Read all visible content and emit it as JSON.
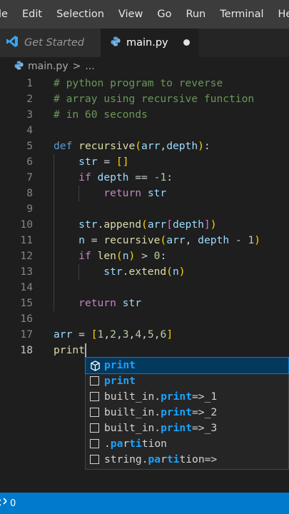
{
  "menubar": {
    "items": [
      "ile",
      "Edit",
      "Selection",
      "View",
      "Go",
      "Run",
      "Terminal",
      "Help"
    ]
  },
  "tabs": [
    {
      "label": "Get Started",
      "icon": "vscode-logo-icon",
      "active": false
    },
    {
      "label": "main.py",
      "icon": "python-icon",
      "active": true,
      "dirty": true
    }
  ],
  "breadcrumb": {
    "file": "main.py",
    "separator": ">",
    "rest": "..."
  },
  "editor": {
    "lines": [
      {
        "n": "1",
        "code": "# python program to reverse"
      },
      {
        "n": "2",
        "code": "# array using recursive function"
      },
      {
        "n": "3",
        "code": "# in 60 seconds"
      },
      {
        "n": "4",
        "code": ""
      },
      {
        "n": "5",
        "code": "def recursive(arr,depth):"
      },
      {
        "n": "6",
        "code": "    str = []"
      },
      {
        "n": "7",
        "code": "    if depth == -1:"
      },
      {
        "n": "8",
        "code": "        return str"
      },
      {
        "n": "9",
        "code": ""
      },
      {
        "n": "10",
        "code": "    str.append(arr[depth])"
      },
      {
        "n": "11",
        "code": "    n = recursive(arr, depth - 1)"
      },
      {
        "n": "12",
        "code": "    if len(n) > 0:"
      },
      {
        "n": "13",
        "code": "        str.extend(n)"
      },
      {
        "n": "14",
        "code": ""
      },
      {
        "n": "15",
        "code": "    return str"
      },
      {
        "n": "16",
        "code": ""
      },
      {
        "n": "17",
        "code": "arr = [1,2,3,4,5,6]"
      },
      {
        "n": "18",
        "code": "print"
      }
    ],
    "active_line": "18"
  },
  "suggestions": [
    {
      "pre": "",
      "match": "print",
      "post": "",
      "icon": "cube-icon",
      "selected": true
    },
    {
      "pre": "",
      "match": "print",
      "post": "",
      "icon": "text-icon",
      "selected": false
    },
    {
      "pre": "built_in.",
      "match": "print",
      "post": "=>_1",
      "icon": "snippet-icon",
      "selected": false
    },
    {
      "pre": "built_in.",
      "match": "print",
      "post": "=>_2",
      "icon": "snippet-icon",
      "selected": false
    },
    {
      "pre": "built_in.",
      "match": "print",
      "post": "=>_3",
      "icon": "snippet-icon",
      "selected": false
    },
    {
      "pre": ".",
      "match": "pa",
      "mid": "r",
      "match2": "ti",
      "post": "tion",
      "icon": "snippet-icon",
      "selected": false
    },
    {
      "pre": "string.",
      "match": "pa",
      "mid": "r",
      "match2": "ti",
      "post": "tion=>",
      "icon": "snippet-icon",
      "selected": false
    }
  ],
  "statusbar": {
    "remote_icon": "remote-icon",
    "count": "0"
  },
  "colors": {
    "comment": "#6a9955",
    "keyword": "#569cd6",
    "control": "#c586c0",
    "function": "#dcdcaa",
    "variable": "#9cdcfe",
    "number": "#b5cea8",
    "bracket1": "#ffd700",
    "bracket2": "#da70d6",
    "bracket3": "#179fff",
    "text": "#d4d4d4",
    "match": "#18a3ff",
    "statusbar": "#007acc"
  }
}
